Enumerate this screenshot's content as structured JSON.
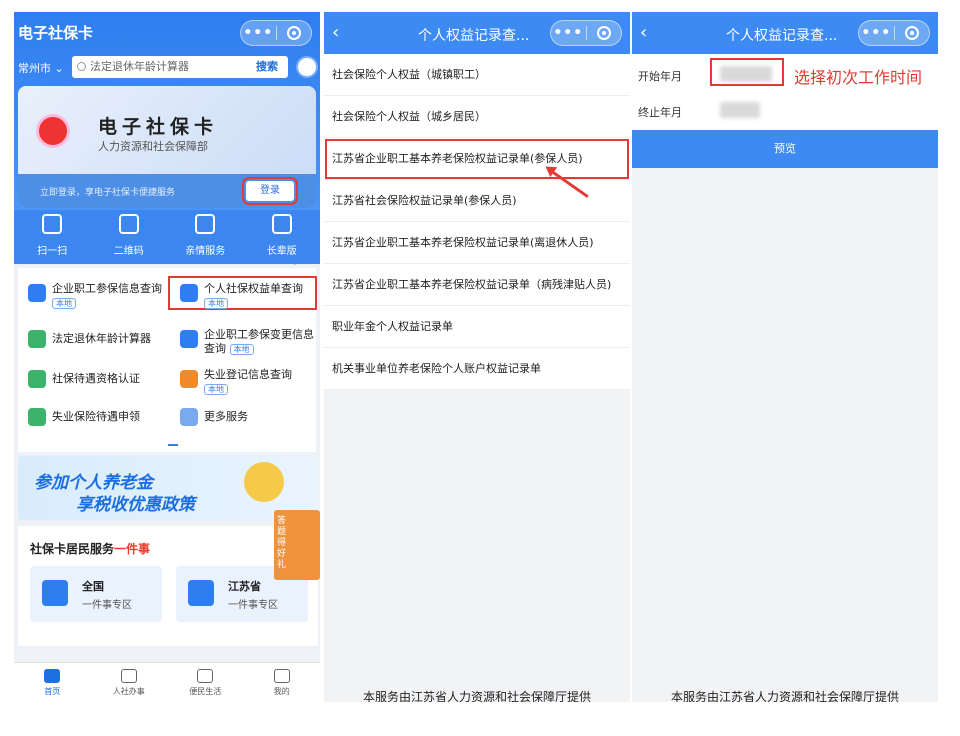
{
  "panel1": {
    "title": "电子社保卡",
    "city": "常州市",
    "search_placeholder": "法定退休年龄计算器",
    "search_button": "搜索",
    "card_title": "电子社保卡",
    "card_subtitle": "人力资源和社会保障部",
    "login_prompt": "立即登录，享电子社保卡便捷服务",
    "login_button": "登录",
    "quick": [
      {
        "label": "扫一扫",
        "icon": "scan-icon"
      },
      {
        "label": "二维码",
        "icon": "qrcode-icon"
      },
      {
        "label": "亲情服务",
        "icon": "family-icon"
      },
      {
        "label": "长辈版",
        "icon": "elder-icon"
      }
    ],
    "services": [
      {
        "label": "企业职工参保信息查询",
        "tag": "本地",
        "color": "#2f7ef0"
      },
      {
        "label": "个人社保权益单查询",
        "tag": "本地",
        "color": "#2f7ef0"
      },
      {
        "label": "法定退休年龄计算器",
        "tag": "",
        "color": "#3bb36b"
      },
      {
        "label": "企业职工参保变更信息查询",
        "tag": "本地",
        "color": "#2f7ef0"
      },
      {
        "label": "社保待遇资格认证",
        "tag": "",
        "color": "#3bb36b"
      },
      {
        "label": "失业登记信息查询",
        "tag": "本地",
        "color": "#f08a2a"
      },
      {
        "label": "失业保险待遇申领",
        "tag": "",
        "color": "#3bb36b"
      },
      {
        "label": "更多服务",
        "tag": "",
        "color": "#7aa9ee"
      }
    ],
    "banner_line1": "参加个人养老金",
    "banner_line2": "享税收优惠政策",
    "side_badge": "答题得好礼",
    "resident_title_a": "社保卡居民服务",
    "resident_title_b": "一件事",
    "resident_boxes": [
      {
        "l1": "全国",
        "l2": "一件事专区"
      },
      {
        "l1": "江苏省",
        "l2": "一件事专区"
      }
    ],
    "tabs": [
      {
        "label": "首页",
        "icon": "home-icon"
      },
      {
        "label": "人社办事",
        "icon": "si-icon"
      },
      {
        "label": "便民生活",
        "icon": "heart-icon"
      },
      {
        "label": "我的",
        "icon": "user-icon"
      }
    ]
  },
  "panel2": {
    "title": "个人权益记录查...",
    "items": [
      "社会保险个人权益（城镇职工）",
      "社会保险个人权益（城乡居民）",
      "江苏省企业职工基本养老保险权益记录单(参保人员)",
      "江苏省社会保险权益记录单(参保人员)",
      "江苏省企业职工基本养老保险权益记录单(离退休人员)",
      "江苏省企业职工基本养老保险权益记录单（病残津贴人员)",
      "职业年金个人权益记录单",
      "机关事业单位养老保险个人账户权益记录单"
    ],
    "footer": "本服务由江苏省人力资源和社会保障厅提供"
  },
  "panel3": {
    "title": "个人权益记录查...",
    "start_label": "开始年月",
    "end_label": "终止年月",
    "annotation": "选择初次工作时间",
    "preview_button": "预览",
    "footer": "本服务由江苏省人力资源和社会保障厅提供"
  },
  "colors": {
    "brand_blue": "#3d8bf2",
    "highlight_red": "#e53935"
  }
}
